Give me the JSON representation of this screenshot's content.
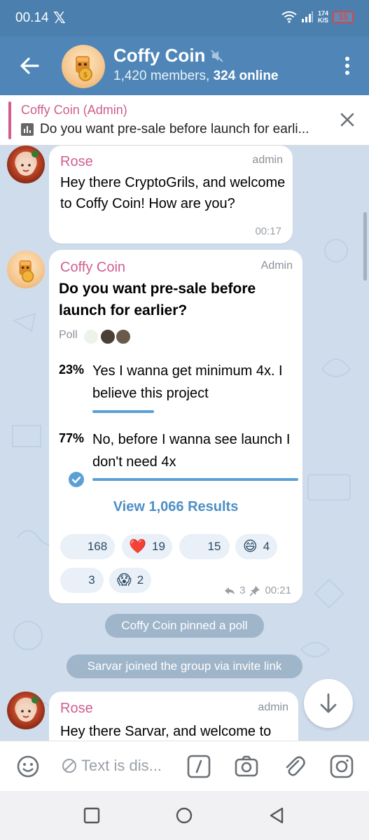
{
  "status_bar": {
    "time": "00.14",
    "x_logo": "𝕏",
    "speed_value": "174",
    "speed_unit": "K/S",
    "battery": "15"
  },
  "header": {
    "title": "Coffy Coin",
    "members": "1,420 members",
    "online": "324 online",
    "muted_icon": "mute-icon"
  },
  "pinned": {
    "title": "Coffy Coin (Admin)",
    "text": "Do you want pre-sale before launch for earli..."
  },
  "messages": {
    "rose_welcome": {
      "sender": "Rose",
      "role": "admin",
      "text": "Hey there CryptoGrils, and welcome to Coffy Coin! How are you?",
      "time": "00:17"
    },
    "poll": {
      "sender": "Coffy Coin",
      "role": "Admin",
      "question": "Do you want pre-sale before launch for earlier?",
      "label": "Poll",
      "options": [
        {
          "percent": "23%",
          "value": 23,
          "text": "Yes I wanna get minimum 4x. I believe this project",
          "selected": false
        },
        {
          "percent": "77%",
          "value": 77,
          "text": "No, before I wanna see launch I don't need 4x",
          "selected": true
        }
      ],
      "view_results": "View 1,066 Results",
      "reactions": [
        {
          "emoji": "",
          "count": "168"
        },
        {
          "emoji": "❤️",
          "count": "19"
        },
        {
          "emoji": "",
          "count": "15"
        },
        {
          "emoji": "😄",
          "count": "4"
        },
        {
          "emoji": "",
          "count": "3"
        },
        {
          "emoji": "😱",
          "count": "2"
        }
      ],
      "forwards": "3",
      "time": "00:21"
    },
    "service_pinned": "Coffy Coin pinned a poll",
    "service_joined": "Sarvar joined the group via invite link",
    "rose_sarvar": {
      "sender": "Rose",
      "role": "admin",
      "text": "Hey there Sarvar, and welcome to"
    }
  },
  "input": {
    "placeholder": "Text is dis..."
  },
  "colors": {
    "header": "#4f86b7",
    "status": "#4a7fae",
    "sender_pink": "#cf5f8e",
    "accent_blue": "#5aa0d4",
    "chat_bg": "#cfdceb"
  }
}
